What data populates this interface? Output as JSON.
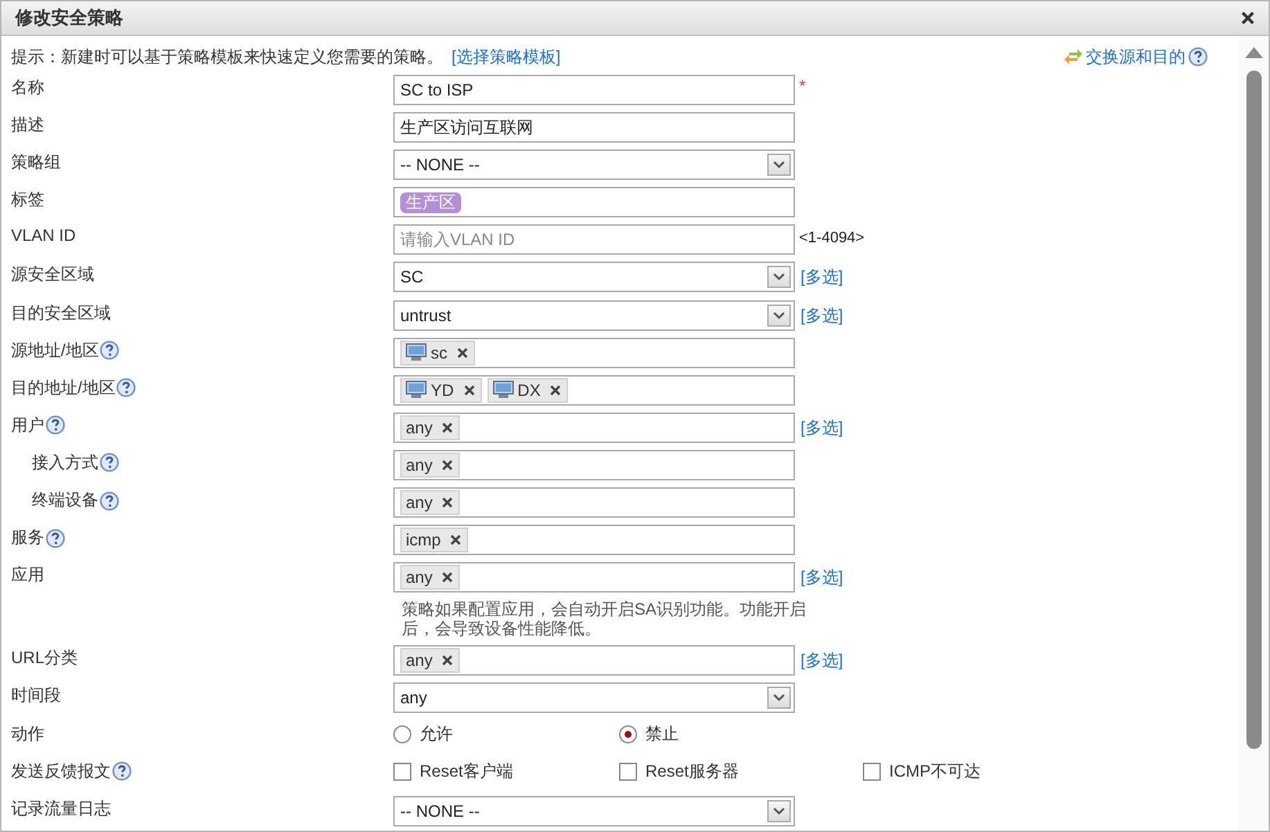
{
  "window": {
    "title": "修改安全策略"
  },
  "hint": {
    "text": "提示：新建时可以基于策略模板来快速定义您需要的策略。",
    "link": "[选择策略模板]"
  },
  "swap_link": {
    "label": "交换源和目的",
    "help": true
  },
  "fields": [
    {
      "label": "名称",
      "help": false,
      "kind": "text",
      "value": "SC to ISP",
      "required_mark": "*"
    },
    {
      "label": "描述",
      "help": false,
      "kind": "text",
      "value": "生产区访问互联网"
    },
    {
      "label": "策略组",
      "help": false,
      "kind": "select",
      "value": "-- NONE --"
    },
    {
      "label": "标签",
      "help": false,
      "kind": "tags",
      "tags": [
        {
          "label": "生产区",
          "color": "#b48fd8"
        }
      ]
    },
    {
      "label": "VLAN ID",
      "help": false,
      "kind": "text",
      "placeholder": "请输入VLAN ID",
      "suffix": "<1-4094>"
    },
    {
      "label": "源安全区域",
      "help": false,
      "kind": "select",
      "value": "SC",
      "link": "[多选]"
    },
    {
      "label": "目的安全区域",
      "help": false,
      "kind": "select",
      "value": "untrust",
      "link": "[多选]"
    },
    {
      "label": "源地址/地区",
      "help": true,
      "kind": "chips",
      "chips": [
        {
          "label": "sc",
          "host": true
        }
      ]
    },
    {
      "label": "目的地址/地区",
      "help": true,
      "kind": "chips",
      "chips": [
        {
          "label": "YD",
          "host": true
        },
        {
          "label": "DX",
          "host": true
        }
      ]
    },
    {
      "label": "用户",
      "help": true,
      "kind": "chips",
      "chips": [
        {
          "label": "any",
          "host": false
        }
      ],
      "link": "[多选]",
      "children": [
        {
          "label": "接入方式",
          "help": true,
          "kind": "chips",
          "chips": [
            {
              "label": "any",
              "host": false
            }
          ]
        },
        {
          "label": "终端设备",
          "help": true,
          "kind": "chips",
          "chips": [
            {
              "label": "any",
              "host": false
            }
          ]
        }
      ]
    },
    {
      "label": "服务",
      "help": true,
      "kind": "chips",
      "chips": [
        {
          "label": "icmp",
          "host": false
        }
      ]
    },
    {
      "label": "应用",
      "help": false,
      "kind": "chips",
      "chips": [
        {
          "label": "any",
          "host": false
        }
      ],
      "link": "[多选]",
      "note": "策略如果配置应用，会自动开启SA识别功能。功能开启后，会导致设备性能降低。"
    },
    {
      "label": "URL分类",
      "help": false,
      "kind": "chips",
      "chips": [
        {
          "label": "any",
          "host": false
        }
      ],
      "link": "[多选]"
    },
    {
      "label": "时间段",
      "help": false,
      "kind": "select",
      "value": "any"
    },
    {
      "label": "动作",
      "help": false,
      "kind": "radio",
      "options": [
        {
          "label": "允许",
          "selected": false
        },
        {
          "label": "禁止",
          "selected": true
        }
      ]
    },
    {
      "label": "发送反馈报文",
      "help": true,
      "kind": "checkbox",
      "options": [
        {
          "label": "Reset客户端",
          "checked": false
        },
        {
          "label": "Reset服务器",
          "checked": false
        },
        {
          "label": "ICMP不可达",
          "checked": false
        }
      ]
    },
    {
      "label": "记录流量日志",
      "help": false,
      "kind": "select",
      "value": "-- NONE --"
    }
  ]
}
